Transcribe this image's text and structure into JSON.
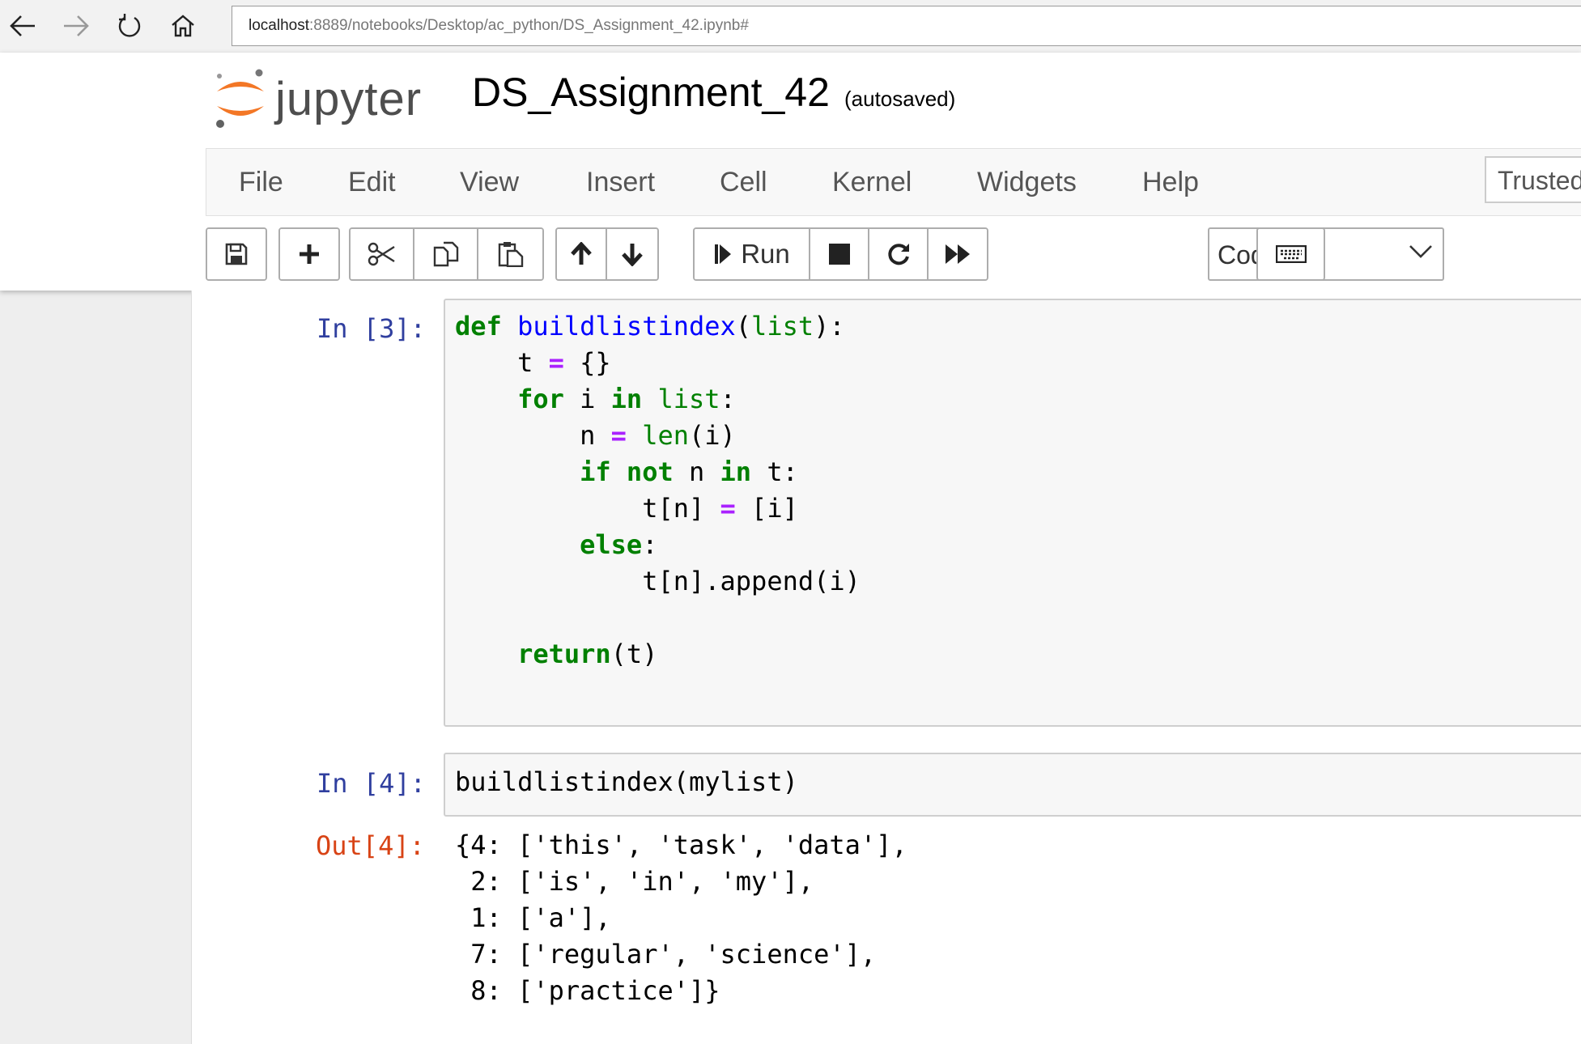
{
  "browser": {
    "url_host": "localhost",
    "url_rest": ":8889/notebooks/Desktop/ac_python/DS_Assignment_42.ipynb#"
  },
  "header": {
    "logo_text": "jupyter",
    "notebook_name": "DS_Assignment_42",
    "save_status": "(autosaved)"
  },
  "menu": {
    "items": [
      "File",
      "Edit",
      "View",
      "Insert",
      "Cell",
      "Kernel",
      "Widgets",
      "Help"
    ],
    "trusted_label": "Trusted"
  },
  "toolbar": {
    "run_label": "Run",
    "cell_type": "Code",
    "icons": [
      "save-icon",
      "plus-icon",
      "scissors-icon",
      "copy-icon",
      "paste-icon",
      "arrow-up-icon",
      "arrow-down-icon",
      "step-forward-icon",
      "stop-icon",
      "restart-icon",
      "fast-forward-icon",
      "keyboard-icon"
    ]
  },
  "cells": [
    {
      "prompt": "In [3]:",
      "lines": [
        [
          {
            "t": "def",
            "c": "kw"
          },
          {
            "t": " "
          },
          {
            "t": "buildlistindex",
            "c": "fn"
          },
          {
            "t": "("
          },
          {
            "t": "list",
            "c": "bi"
          },
          {
            "t": "):"
          }
        ],
        [
          {
            "t": "    t "
          },
          {
            "t": "=",
            "c": "op"
          },
          {
            "t": " {}"
          }
        ],
        [
          {
            "t": "    "
          },
          {
            "t": "for",
            "c": "kw"
          },
          {
            "t": " i "
          },
          {
            "t": "in",
            "c": "kw"
          },
          {
            "t": " "
          },
          {
            "t": "list",
            "c": "bi"
          },
          {
            "t": ":"
          }
        ],
        [
          {
            "t": "        n "
          },
          {
            "t": "=",
            "c": "op"
          },
          {
            "t": " "
          },
          {
            "t": "len",
            "c": "bi"
          },
          {
            "t": "(i)"
          }
        ],
        [
          {
            "t": "        "
          },
          {
            "t": "if",
            "c": "kw"
          },
          {
            "t": " "
          },
          {
            "t": "not",
            "c": "kw"
          },
          {
            "t": " n "
          },
          {
            "t": "in",
            "c": "kw"
          },
          {
            "t": " t:"
          }
        ],
        [
          {
            "t": "            t[n] "
          },
          {
            "t": "=",
            "c": "op"
          },
          {
            "t": " [i]"
          }
        ],
        [
          {
            "t": "        "
          },
          {
            "t": "else",
            "c": "kw"
          },
          {
            "t": ":"
          }
        ],
        [
          {
            "t": "            t[n].append(i)"
          }
        ],
        [
          {
            "t": ""
          }
        ],
        [
          {
            "t": "    "
          },
          {
            "t": "return",
            "c": "kw"
          },
          {
            "t": "(t)"
          }
        ]
      ]
    },
    {
      "prompt": "In [4]:",
      "lines": [
        [
          {
            "t": "buildlistindex(mylist)"
          }
        ]
      ],
      "out_prompt": "Out[4]:",
      "output": "{4: ['this', 'task', 'data'],\n 2: ['is', 'in', 'my'],\n 1: ['a'],\n 7: ['regular', 'science'],\n 8: ['practice']}"
    }
  ]
}
